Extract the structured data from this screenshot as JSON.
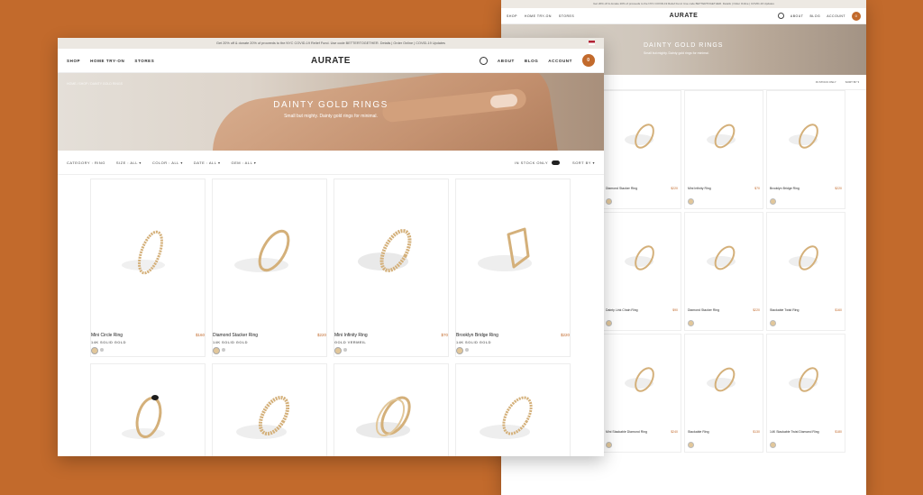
{
  "brand": "AURATE",
  "promo": "Get 20% off & donate 20% of proceeds to the NYC COVID-19 Relief Fund. Use code BETTERTOGETHER. Details | Order Online | COVID-19 Updates",
  "nav": {
    "left": [
      "SHOP",
      "HOME TRY-ON",
      "STORES"
    ],
    "right": [
      "ABOUT",
      "BLOG",
      "ACCOUNT"
    ],
    "bag_count": "0"
  },
  "hero": {
    "title": "DAINTY GOLD RINGS",
    "subtitle": "Small but mighty. Dainty gold rings for minimal.",
    "crumbs": "HOME / SHOP / DAINTY GOLD RINGS"
  },
  "filters": [
    "CATEGORY : RING",
    "SIZE : ALL ▾",
    "COLOR : ALL ▾",
    "DATE : ALL ▾",
    "GEM : ALL ▾"
  ],
  "in_stock_label": "IN STOCK ONLY",
  "sort_label": "SORT BY ▾",
  "products": [
    {
      "name": "Mini Circle Ring",
      "price": "$160",
      "metal": "14K SOLID GOLD"
    },
    {
      "name": "Diamond Stacker Ring",
      "price": "$220",
      "metal": "14K SOLID GOLD"
    },
    {
      "name": "Mini Infinity Ring",
      "price": "$70",
      "metal": "GOLD VERMEIL"
    },
    {
      "name": "Brooklyn Bridge Ring",
      "price": "$220",
      "metal": "14K SOLID GOLD"
    }
  ],
  "back_products": [
    {
      "name": "Diamond Stacker Ring",
      "price": "$220"
    },
    {
      "name": "Mini Infinity Ring",
      "price": "$70"
    },
    {
      "name": "Brooklyn Bridge Ring",
      "price": "$220"
    },
    {
      "name": "Dainty Link Chain Ring",
      "price": "$90"
    },
    {
      "name": "Diamond Stacker Ring",
      "price": "$220"
    },
    {
      "name": "Stackable Twist Ring",
      "price": "$160"
    },
    {
      "name": "Mini Stackable Diamond Ring",
      "price": "$240"
    },
    {
      "name": "Stackable Ring",
      "price": "$130"
    },
    {
      "name": "14K Stackable Twist Diamond Ring",
      "price": "$180"
    }
  ]
}
